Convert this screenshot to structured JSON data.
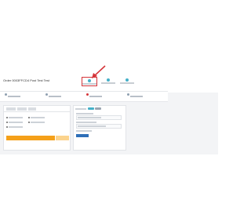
{
  "header": {
    "title": "Order 0003FFCD4 Post Test Test"
  },
  "stepper": {
    "steps": [
      {
        "name": "step-1",
        "state": "active"
      },
      {
        "name": "step-2",
        "state": "done"
      },
      {
        "name": "step-3",
        "state": "done"
      }
    ]
  },
  "colors": {
    "accent": "#45b0c8",
    "highlight": "#d5353a",
    "primary_button": "#f5a019",
    "secondary_button": "#fbd38d",
    "link_button": "#2e6fb8"
  }
}
